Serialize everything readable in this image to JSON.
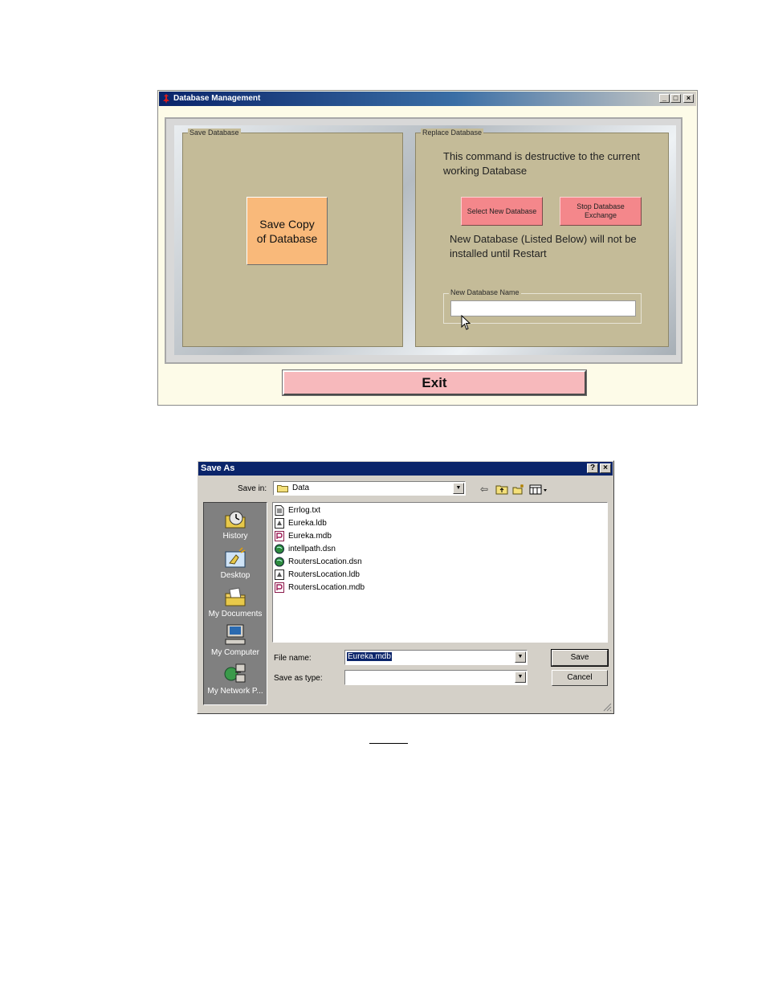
{
  "db_window": {
    "title": "Database Management",
    "save_panel": {
      "legend": "Save Database",
      "save_copy_label": "Save Copy\nof Database",
      "save_copy_color": "#f9b97a"
    },
    "replace_panel": {
      "legend": "Replace Database",
      "warning": "This command is destructive to the current working Database",
      "select_new_label": "Select New Database",
      "stop_exchange_label": "Stop Database Exchange",
      "restart_note": "New Database (Listed Below) will not be installed until Restart",
      "new_name_legend": "New Database Name",
      "new_name_value": ""
    },
    "exit_label": "Exit",
    "colors": {
      "panel": "#c4bb98",
      "pink_button": "#f4878b",
      "exit_button": "#f7b9bc"
    }
  },
  "saveas_window": {
    "title": "Save As",
    "save_in_label": "Save in:",
    "save_in_value": "Data",
    "places": [
      {
        "label": "History",
        "icon": "history-icon"
      },
      {
        "label": "Desktop",
        "icon": "desktop-icon"
      },
      {
        "label": "My Documents",
        "icon": "my-documents-icon"
      },
      {
        "label": "My Computer",
        "icon": "my-computer-icon"
      },
      {
        "label": "My Network P...",
        "icon": "my-network-places-icon"
      }
    ],
    "files": [
      {
        "name": "Errlog.txt",
        "icon": "text-file-icon"
      },
      {
        "name": "Eureka.ldb",
        "icon": "ldb-file-icon"
      },
      {
        "name": "Eureka.mdb",
        "icon": "access-db-icon"
      },
      {
        "name": "intellpath.dsn",
        "icon": "dsn-file-icon"
      },
      {
        "name": "RoutersLocation.dsn",
        "icon": "dsn-file-icon"
      },
      {
        "name": "RoutersLocation.ldb",
        "icon": "ldb-file-icon"
      },
      {
        "name": "RoutersLocation.mdb",
        "icon": "access-db-icon"
      }
    ],
    "file_name_label": "File name:",
    "file_name_value": "Eureka.mdb",
    "save_type_label": "Save as type:",
    "save_type_value": "",
    "save_button": "Save",
    "cancel_button": "Cancel"
  }
}
